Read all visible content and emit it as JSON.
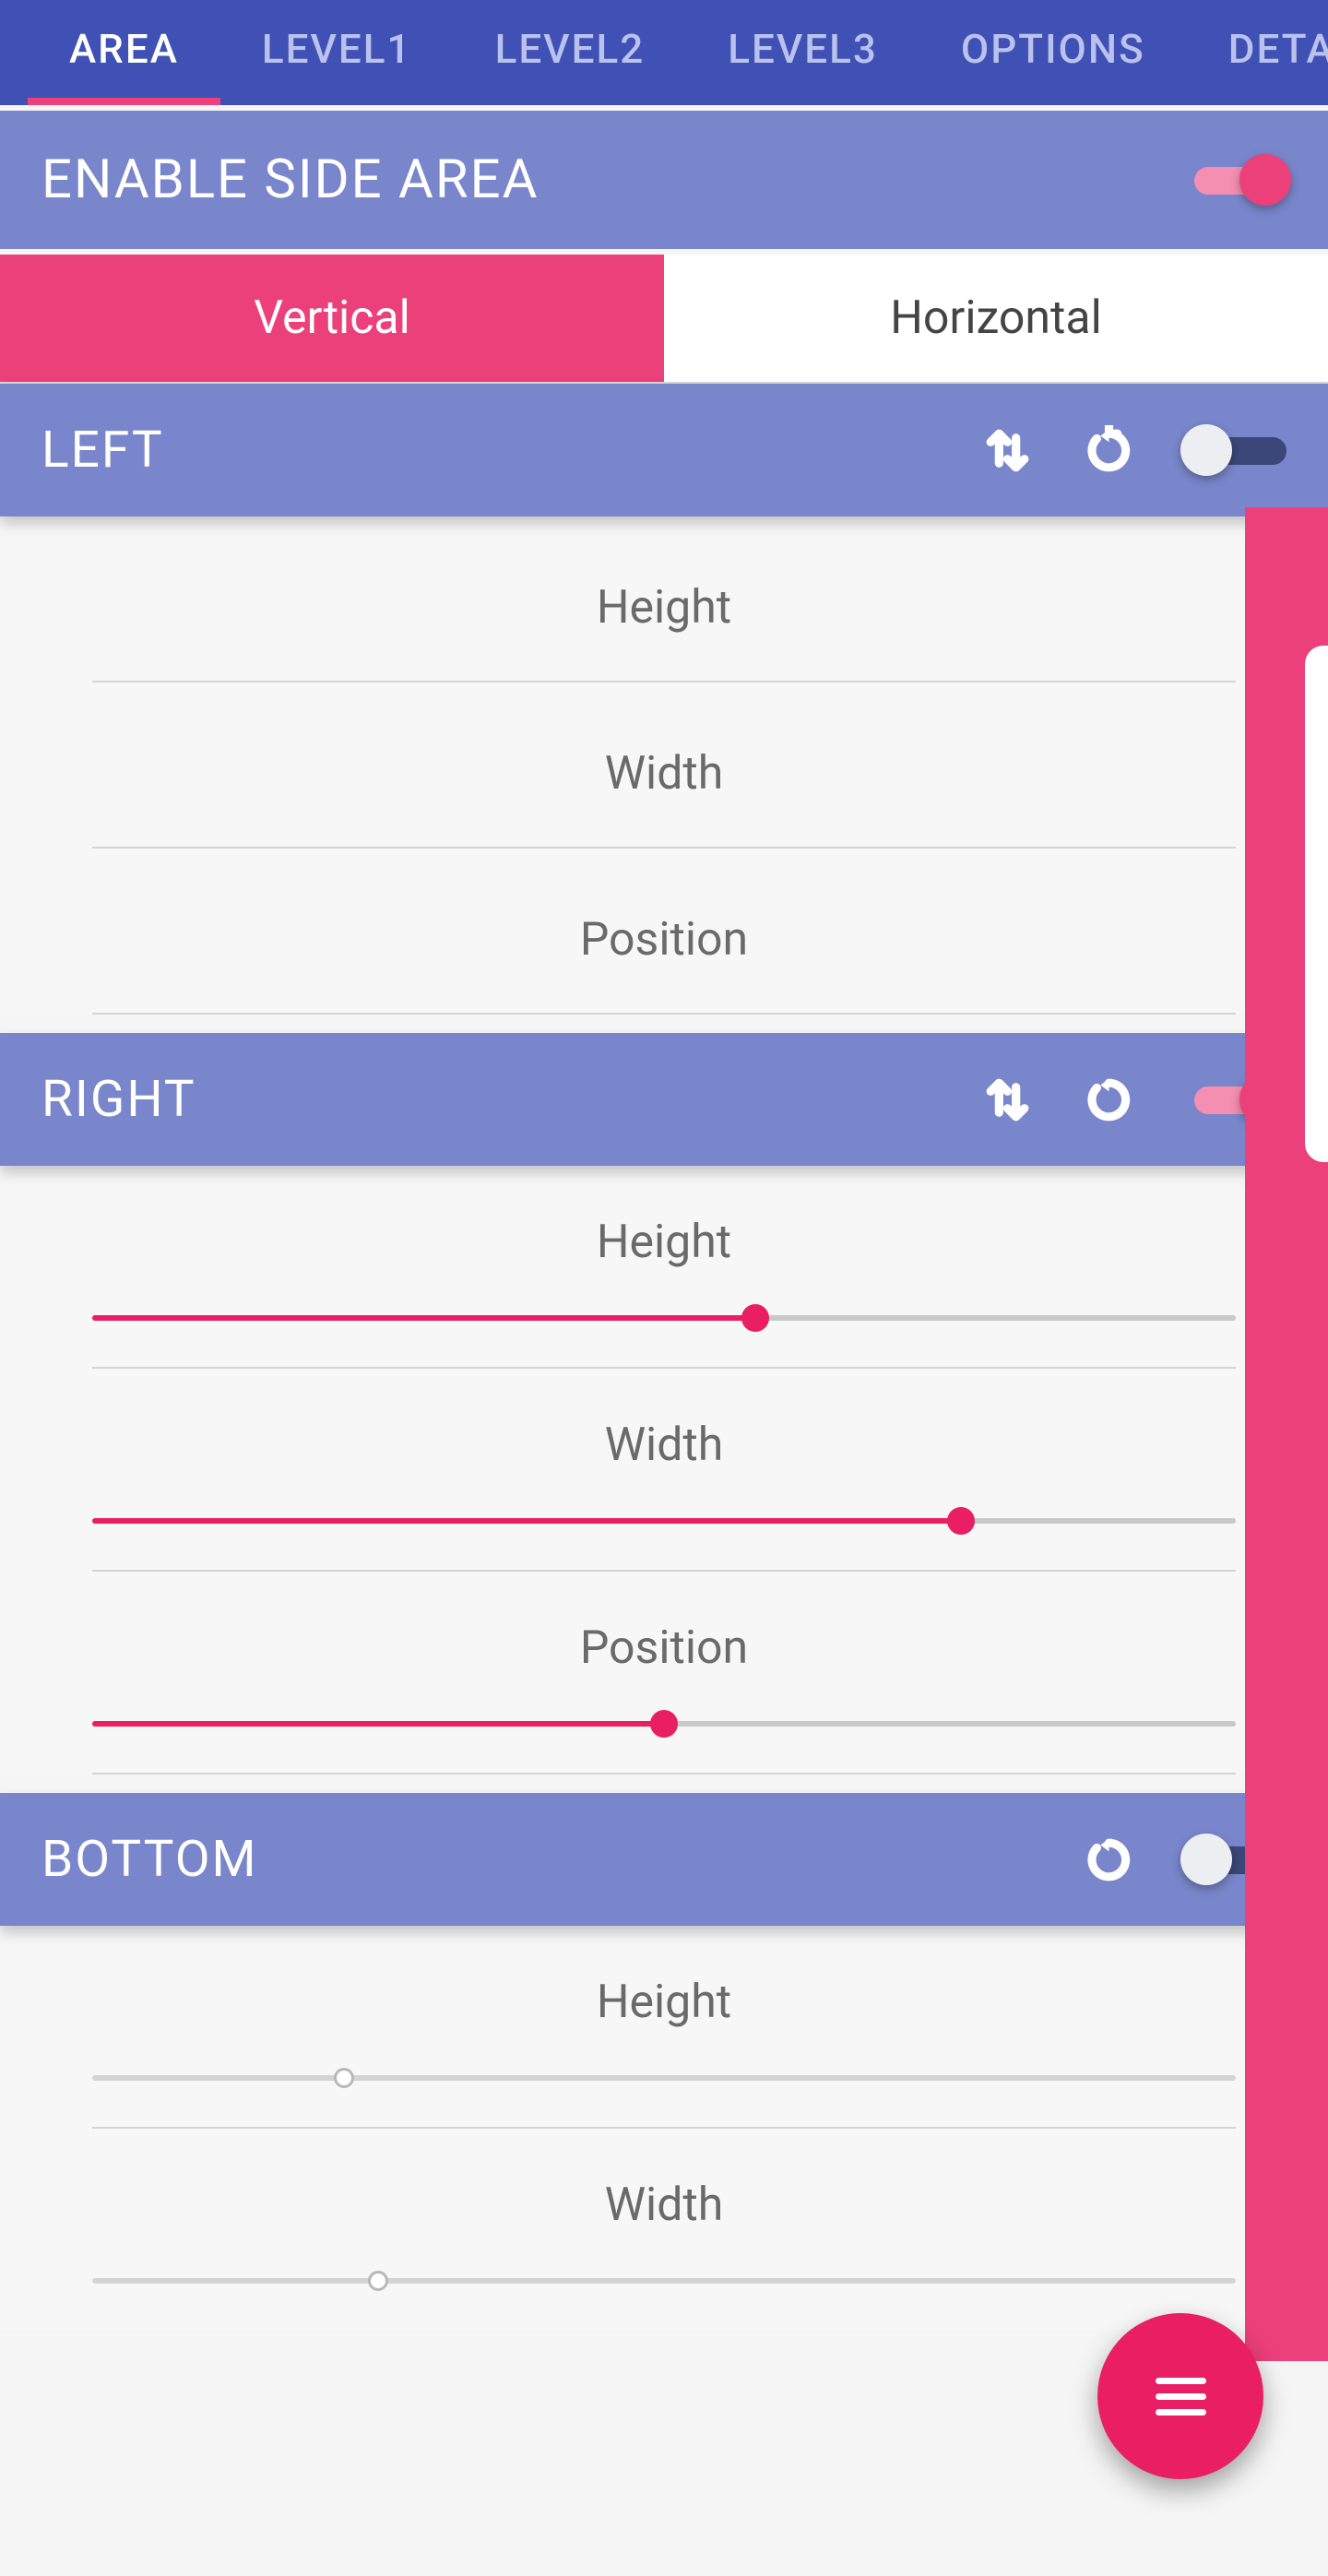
{
  "tabs": [
    "AREA",
    "LEVEL1",
    "LEVEL2",
    "LEVEL3",
    "OPTIONS",
    "DETAIL"
  ],
  "active_tab": "AREA",
  "enable_side_area": {
    "label": "ENABLE SIDE AREA",
    "on": true
  },
  "orientation": {
    "vertical": "Vertical",
    "horizontal": "Horizontal",
    "active": "Vertical"
  },
  "sections": {
    "left": {
      "title": "LEFT",
      "toggle_on": false,
      "has_swap": true,
      "items": [
        {
          "label": "Height"
        },
        {
          "label": "Width"
        },
        {
          "label": "Position"
        }
      ]
    },
    "right": {
      "title": "RIGHT",
      "toggle_on": true,
      "has_swap": true,
      "items": [
        {
          "label": "Height",
          "value": 58
        },
        {
          "label": "Width",
          "value": 76
        },
        {
          "label": "Position",
          "value": 50
        }
      ]
    },
    "bottom": {
      "title": "BOTTOM",
      "toggle_on": false,
      "has_swap": false,
      "items": [
        {
          "label": "Height",
          "value": 22
        },
        {
          "label": "Width",
          "value": 25
        }
      ]
    }
  },
  "colors": {
    "primary": "#3f51b5",
    "primary_light": "#7986cb",
    "accent": "#ec407a"
  }
}
